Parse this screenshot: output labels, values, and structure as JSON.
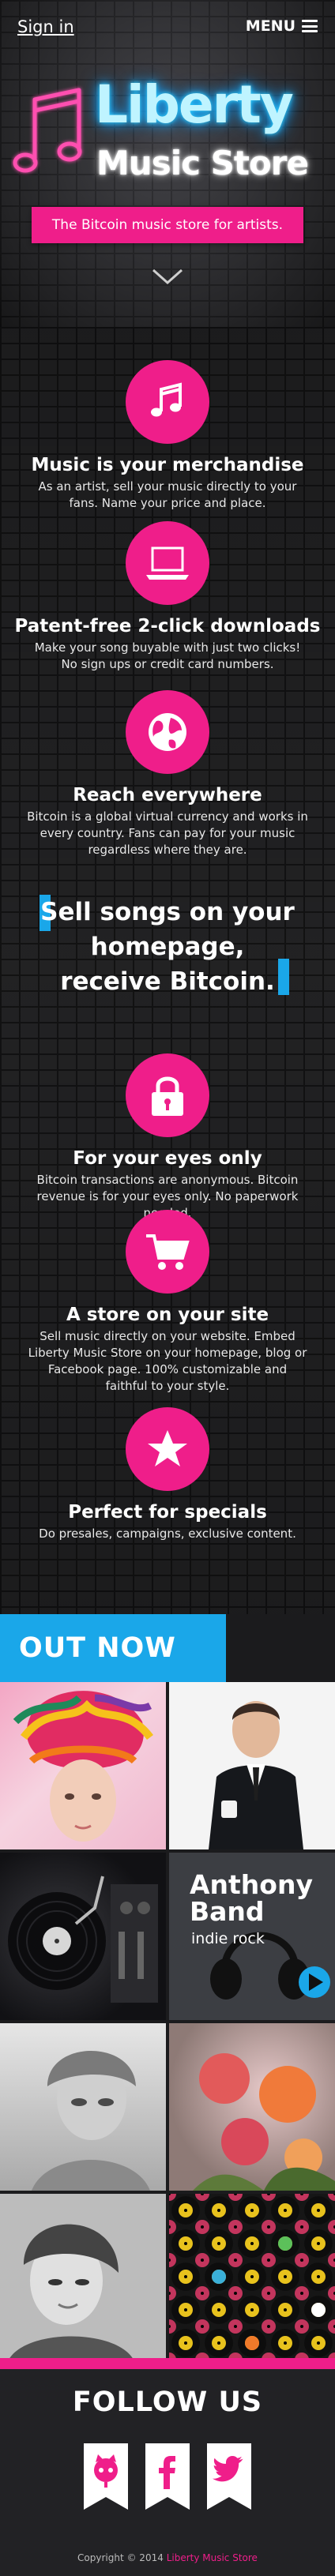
{
  "header": {
    "signin_label": "Sign in",
    "menu_label": "MENU"
  },
  "logo": {
    "title": "Liberty",
    "subtitle": "Music Store"
  },
  "tagline": "The Bitcoin music store for artists.",
  "features": [
    {
      "icon": "music-note-icon",
      "title": "Music is your merchandise",
      "text": "As an artist, sell your music directly to your fans. Name your price and place."
    },
    {
      "icon": "laptop-icon",
      "title": "Patent-free 2-click downloads",
      "text": "Make your song buyable with just two clicks! No sign ups or credit card numbers."
    },
    {
      "icon": "globe-icon",
      "title": "Reach everywhere",
      "text": "Bitcoin is a global virtual currency and works in every country. Fans can pay for your music regardless where they are."
    },
    {
      "icon": "lock-icon",
      "title": "For your eyes only",
      "text": "Bitcoin transactions are anonymous. Bitcoin revenue is for your eyes only. No paperwork needed."
    },
    {
      "icon": "cart-icon",
      "title": "A store on your site",
      "text": "Sell music directly on your website. Embed Liberty Music Store on your homepage, blog or Facebook page. 100% customizable and faithful to your style."
    },
    {
      "icon": "star-icon",
      "title": "Perfect for specials",
      "text": "Do presales, campaigns, exclusive content."
    }
  ],
  "quote": {
    "line1": "Sell songs on your",
    "line2": "homepage,",
    "line3": "receive Bitcoin."
  },
  "out_now": {
    "heading": "OUT NOW",
    "featured": {
      "name_line1": "Anthony",
      "name_line2": "Band",
      "genre": "indie rock"
    }
  },
  "follow": {
    "heading": "FOLLOW US",
    "icons": [
      "github-icon",
      "facebook-icon",
      "twitter-icon"
    ]
  },
  "footer": {
    "copyright": "Copyright © 2014",
    "brand": "Liberty Music Store"
  },
  "colors": {
    "accent_pink": "#ef1e8a",
    "accent_blue": "#1aa7e9",
    "neon_blue": "#2fd3ff"
  }
}
